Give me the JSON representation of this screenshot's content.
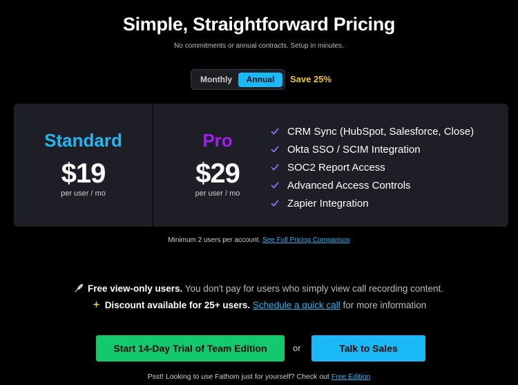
{
  "header": {
    "title": "Simple, Straightforward Pricing",
    "subtitle": "No commitments or annual contracts. Setup in minutes."
  },
  "billing_toggle": {
    "options": [
      "Monthly",
      "Annual"
    ],
    "selected": "Annual",
    "save_label": "Save 25%"
  },
  "plans": [
    {
      "name": "Standard",
      "price": "$19",
      "unit": "per user / mo",
      "color": "#23b7f2"
    },
    {
      "name": "Pro",
      "price": "$29",
      "unit": "per user / mo",
      "color": "#a020f0"
    }
  ],
  "pro_features": [
    "CRM Sync (HubSpot, Salesforce, Close)",
    "Okta SSO / SCIM Integration",
    "SOC2 Report Access",
    "Advanced Access Controls",
    "Zapier Integration"
  ],
  "minimum_note": {
    "text": "Minimum 2 users per account. ",
    "link": "See Full Pricing Comparison"
  },
  "info": {
    "line1_icon": "rocket-icon",
    "line1_bold": "Free view-only users.",
    "line1_rest": " You don't pay for users who simply view call recording content.",
    "line2_icon": "sparkle-icon",
    "line2_bold": "Discount available for 25+ users.",
    "line2_link": "Schedule a quick call",
    "line2_rest": " for more information"
  },
  "cta": {
    "trial_label": "Start 14-Day Trial of Team Edition",
    "or_label": "or",
    "sales_label": "Talk to Sales"
  },
  "footer": {
    "text": "Psst! Looking to use Fathom just for yourself? Check out ",
    "link": "Free Edition"
  },
  "colors": {
    "accent_blue": "#1ab8f5",
    "accent_green": "#12c96b",
    "accent_purple": "#a020f0",
    "save_yellow": "#f4c430",
    "check_purple": "#9b6dff"
  }
}
